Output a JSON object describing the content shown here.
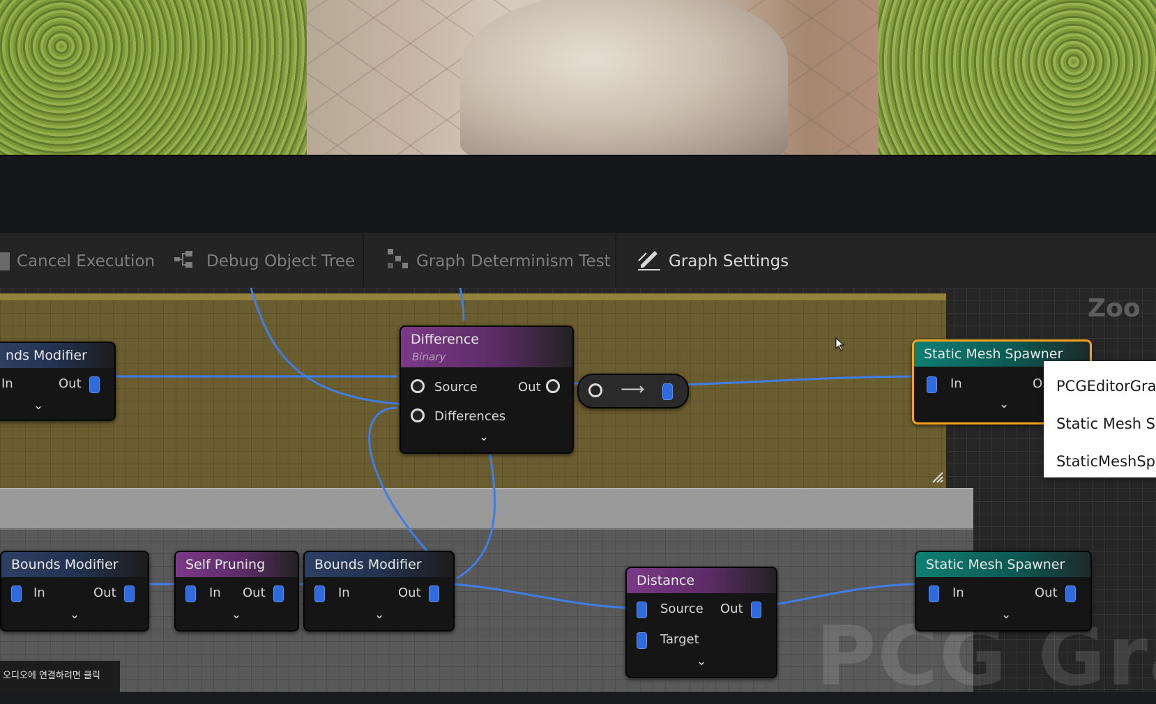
{
  "toolbar": {
    "cancel_execution": "Cancel Execution",
    "debug_object_tree": "Debug Object Tree",
    "graph_determinism_test": "Graph Determinism Test",
    "graph_settings": "Graph Settings"
  },
  "graph": {
    "zoom_label": "Zoo",
    "watermark": "PCG Grap"
  },
  "nodes": {
    "bounds_modifier_top": {
      "title": "nds Modifier",
      "in": "In",
      "out": "Out"
    },
    "difference": {
      "title": "Difference",
      "subtitle": "Binary",
      "source": "Source",
      "differences": "Differences",
      "out": "Out"
    },
    "static_mesh_spawner_top": {
      "title": "Static Mesh Spawner",
      "in": "In",
      "out": "O"
    },
    "bounds_modifier_1": {
      "title": "Bounds Modifier",
      "in": "In",
      "out": "Out"
    },
    "self_pruning": {
      "title": "Self Pruning",
      "in": "In",
      "out": "Out"
    },
    "bounds_modifier_2": {
      "title": "Bounds Modifier",
      "in": "In",
      "out": "Out"
    },
    "distance": {
      "title": "Distance",
      "source": "Source",
      "target": "Target",
      "out": "Out"
    },
    "static_mesh_spawner_bottom": {
      "title": "Static Mesh Spawner",
      "in": "In",
      "out": "Out"
    }
  },
  "context_menu": {
    "items": [
      "PCGEditorGra",
      "Static Mesh S",
      "StaticMeshSp"
    ]
  },
  "status_overlay": {
    "text": "오디오에 연결하려면 클릭"
  },
  "colors": {
    "selection": "#f4a31c",
    "wire": "#3f7ee8",
    "comment_top": "#706230",
    "pin_blue": "#2f6bdc"
  }
}
